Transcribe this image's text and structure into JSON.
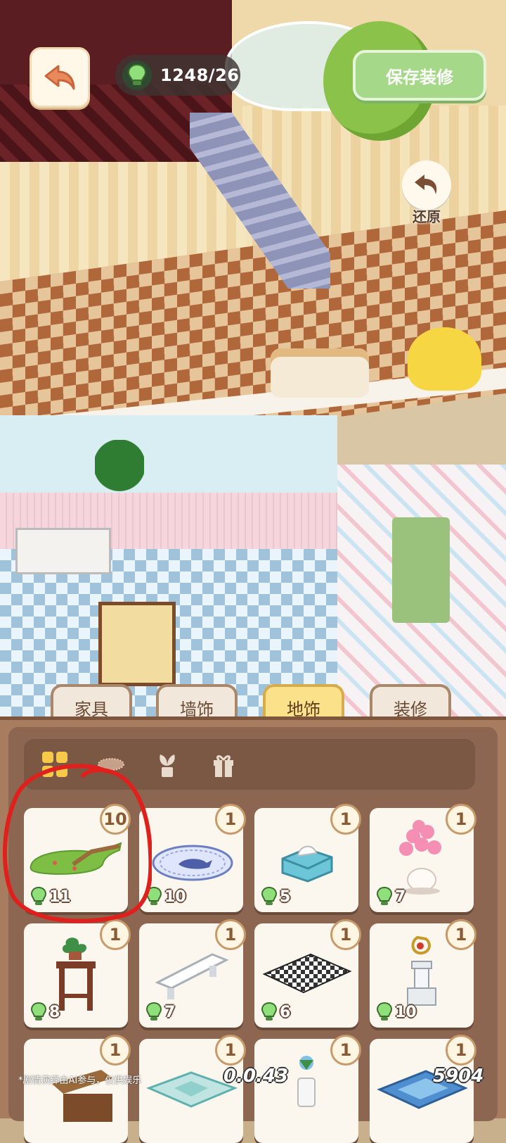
{
  "hud": {
    "energy_value": "1248/26",
    "save_label": "保存装修",
    "restore_label": "还原",
    "back_icon": "back-arrow-icon",
    "energy_icon": "lightbulb-icon"
  },
  "tabs": [
    {
      "label": "家具",
      "active": false
    },
    {
      "label": "墙饰",
      "active": false
    },
    {
      "label": "地饰",
      "active": true
    },
    {
      "label": "装修",
      "active": false
    }
  ],
  "subcategories": [
    {
      "icon": "grid-all-icon",
      "active": true
    },
    {
      "icon": "rug-icon",
      "active": false
    },
    {
      "icon": "plant-icon",
      "active": false
    },
    {
      "icon": "gift-icon",
      "active": false
    }
  ],
  "items": [
    {
      "name": "green-leaf-rug",
      "count": "10",
      "price": "11"
    },
    {
      "name": "blue-oval-rug",
      "count": "1",
      "price": "10"
    },
    {
      "name": "tissue-box",
      "count": "1",
      "price": "5"
    },
    {
      "name": "pink-flower-vase",
      "count": "1",
      "price": "7"
    },
    {
      "name": "plant-stand",
      "count": "1",
      "price": "8"
    },
    {
      "name": "white-bench",
      "count": "1",
      "price": "7"
    },
    {
      "name": "checkered-rug",
      "count": "1",
      "price": "6"
    },
    {
      "name": "trophy-pedestal",
      "count": "1",
      "price": "10"
    },
    {
      "name": "wooden-cabinet",
      "count": "1",
      "price": ""
    },
    {
      "name": "teal-ornate-rug",
      "count": "1",
      "price": ""
    },
    {
      "name": "flower-pot-white",
      "count": "1",
      "price": ""
    },
    {
      "name": "blue-pattern-rug",
      "count": "1",
      "price": ""
    }
  ],
  "footer": {
    "disclaimer": "*剧情演绎由AI参与，仅供娱乐",
    "version": "0.0.43",
    "user_code": "5904"
  },
  "colors": {
    "save_button": "#a6d88a",
    "active_tab": "#fbe28a",
    "panel": "#a87d5f",
    "annotation": "#e0201c"
  }
}
